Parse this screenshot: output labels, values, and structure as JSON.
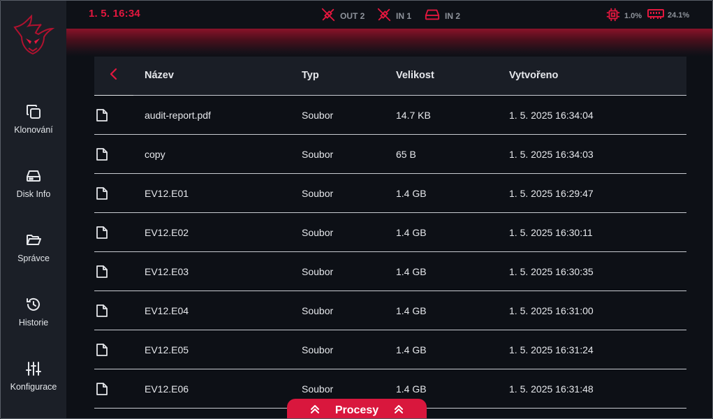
{
  "colors": {
    "accent": "#e3173e",
    "sidebar_bg": "#1b1f27",
    "background": "#0d1016",
    "muted": "#8e939b"
  },
  "topbar": {
    "datetime": "1. 5. 16:34",
    "ports": [
      {
        "icon": "disconnected-cable-icon",
        "label": "OUT 2"
      },
      {
        "icon": "disconnected-cable-icon",
        "label": "IN 1"
      },
      {
        "icon": "drive-icon",
        "label": "IN 2"
      }
    ],
    "cpu": {
      "icon": "cpu-icon",
      "value": "1.0%"
    },
    "ram": {
      "icon": "memory-icon",
      "value": "24.1%"
    }
  },
  "sidebar": {
    "items": [
      {
        "icon": "copy-icon",
        "label": "Klonování"
      },
      {
        "icon": "drive-icon",
        "label": "Disk Info"
      },
      {
        "icon": "folder-open-icon",
        "label": "Správce"
      },
      {
        "icon": "history-icon",
        "label": "Historie"
      },
      {
        "icon": "sliders-icon",
        "label": "Konfigurace"
      }
    ]
  },
  "table": {
    "columns": {
      "name": "Název",
      "type": "Typ",
      "size": "Velikost",
      "created": "Vytvořeno"
    },
    "rows": [
      {
        "name": "audit-report.pdf",
        "type": "Soubor",
        "size": "14.7 KB",
        "created": "1. 5. 2025 16:34:04"
      },
      {
        "name": "copy",
        "type": "Soubor",
        "size": "65 B",
        "created": "1. 5. 2025 16:34:03"
      },
      {
        "name": "EV12.E01",
        "type": "Soubor",
        "size": "1.4 GB",
        "created": "1. 5. 2025 16:29:47"
      },
      {
        "name": "EV12.E02",
        "type": "Soubor",
        "size": "1.4 GB",
        "created": "1. 5. 2025 16:30:11"
      },
      {
        "name": "EV12.E03",
        "type": "Soubor",
        "size": "1.4 GB",
        "created": "1. 5. 2025 16:30:35"
      },
      {
        "name": "EV12.E04",
        "type": "Soubor",
        "size": "1.4 GB",
        "created": "1. 5. 2025 16:31:00"
      },
      {
        "name": "EV12.E05",
        "type": "Soubor",
        "size": "1.4 GB",
        "created": "1. 5. 2025 16:31:24"
      },
      {
        "name": "EV12.E06",
        "type": "Soubor",
        "size": "1.4 GB",
        "created": "1. 5. 2025 16:31:48"
      }
    ]
  },
  "procesy": {
    "label": "Procesy"
  }
}
